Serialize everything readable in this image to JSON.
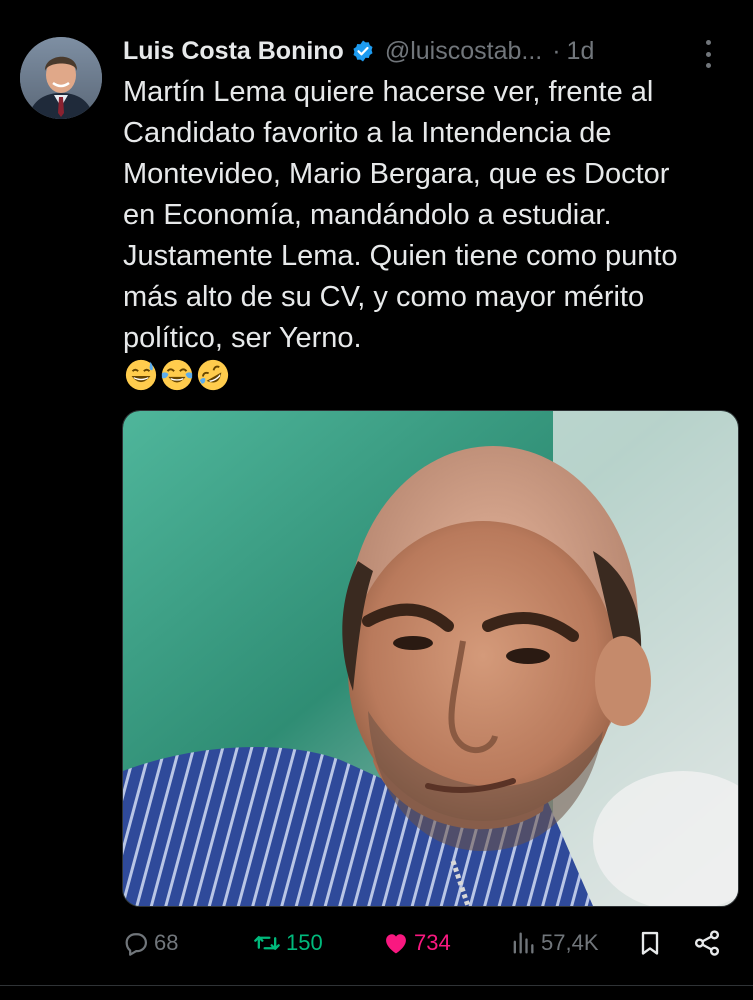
{
  "tweet": {
    "author_name": "Luis Costa Bonino",
    "handle": "@luiscostab...",
    "separator": "·",
    "time": "1d",
    "text_lines": [
      "Martín Lema quiere hacerse ver, frente al",
      "Candidato favorito a la Intendencia de",
      "Montevideo, Mario Bergara, que es Doctor",
      "en Economía, mandándolo a estudiar.",
      "Justamente Lema. Quien tiene como punto",
      "más alto de su CV, y como mayor mérito",
      "político, ser Yerno."
    ],
    "emojis": [
      "grinning-sweat-emoji",
      "joy-emoji",
      "rofl-emoji"
    ]
  },
  "actions": {
    "reply_count": "68",
    "retweet_count": "150",
    "like_count": "734",
    "view_count": "57,4K"
  },
  "icons": {
    "verified": "verified-badge-icon",
    "more": "more-vertical-icon",
    "reply": "reply-icon",
    "retweet": "retweet-icon",
    "like": "heart-icon",
    "views": "views-icon",
    "bookmark": "bookmark-icon",
    "share": "share-icon"
  },
  "colors": {
    "background": "#000000",
    "text": "#e7e9ea",
    "muted": "#71767b",
    "verified": "#1d9bf0",
    "retweet_active": "#00ba7c",
    "like_active": "#f91880"
  }
}
